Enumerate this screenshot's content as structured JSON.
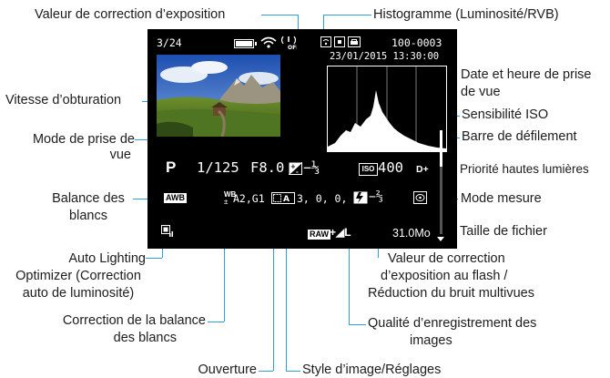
{
  "callouts": {
    "exposure_comp": "Valeur de correction d’exposition",
    "histogram": "Histogramme (Luminosité/RVB)",
    "datetime": [
      "Date et heure de prise",
      "de vue"
    ],
    "shutter": "Vitesse d’obturation",
    "iso": "Sensibilité ISO",
    "shooting_mode": [
      "Mode de prise de",
      "vue"
    ],
    "scrollbar": "Barre de défilement",
    "highlight_priority": "Priorité hautes lumières",
    "white_balance": [
      "Balance des",
      "blancs"
    ],
    "metering": "Mode mesure",
    "file_size": "Taille de fichier",
    "alo": [
      "Auto Lighting",
      "Optimizer (Correction",
      "auto de luminosité)"
    ],
    "flash_comp": [
      "Valeur de correction",
      "d’exposition au flash /",
      "Réduction du bruit multivues"
    ],
    "wb_correction": [
      "Correction de la balance",
      "des blancs"
    ],
    "quality": [
      "Qualité d’enregistrement des",
      "images"
    ],
    "aperture": "Ouverture",
    "picture_style": "Style d’image/Réglages"
  },
  "screen": {
    "image_counter": "3/24",
    "folder_file": "100-0003",
    "date_time": "23/01/2015 13:30:00",
    "mode": "P",
    "shutter": "1/125",
    "aperture": "F8.0",
    "exposure_comp": "−⅓",
    "iso_badge": "ISO",
    "iso_value": "400",
    "highlight_priority": "D+",
    "wb_badge": "AWB",
    "wb_prefix": "WB",
    "wb_shift": "A2,G1",
    "picture_style_values": "3, 0, 0, 0",
    "flash_comp": "−⅔",
    "raw_badge": "RAW",
    "quality_suffix": "+◢L",
    "file_size": "31.0Mo",
    "icons": {
      "battery": "battery-icon",
      "wifi": "wifi-icon",
      "gps": "gps-off-icon",
      "protect": "protect-icon",
      "rating": "rating-icon",
      "metering": "evaluative-metering-icon",
      "alo": "alo-icon",
      "picture_style": "picture-style-icon"
    }
  },
  "colors": {
    "leader": "#2ea0d8",
    "screen_bg": "#000000",
    "screen_text": "#ffffff",
    "histogram_fill": "#ffffff"
  }
}
